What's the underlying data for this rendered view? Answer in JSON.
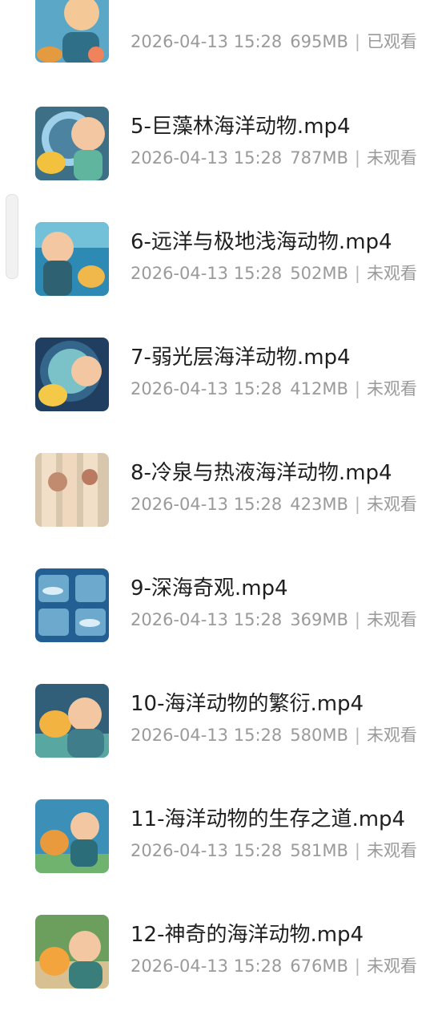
{
  "videos": [
    {
      "title": "",
      "date": "2026-04-13 15:28",
      "size": "695MB",
      "separator": "|",
      "status": "已观看",
      "thumb_colors": [
        "#5aa7c7",
        "#e49a3f",
        "#2f6f88"
      ]
    },
    {
      "title": "5-巨藻林海洋动物.mp4",
      "date": "2026-04-13 15:28",
      "size": "787MB",
      "separator": "|",
      "status": "未观看",
      "thumb_colors": [
        "#3d6f86",
        "#f2c23f",
        "#9fd0ea"
      ]
    },
    {
      "title": "6-远洋与极地浅海动物.mp4",
      "date": "2026-04-13 15:28",
      "size": "502MB",
      "separator": "|",
      "status": "未观看",
      "thumb_colors": [
        "#2c8ab4",
        "#f0b74b",
        "#73c1d8"
      ]
    },
    {
      "title": "7-弱光层海洋动物.mp4",
      "date": "2026-04-13 15:28",
      "size": "412MB",
      "separator": "|",
      "status": "未观看",
      "thumb_colors": [
        "#203e5f",
        "#f4c948",
        "#7ac2c8"
      ]
    },
    {
      "title": "8-冷泉与热液海洋动物.mp4",
      "date": "2026-04-13 15:28",
      "size": "423MB",
      "separator": "|",
      "status": "未观看",
      "thumb_colors": [
        "#d8c7ad",
        "#c18b6f",
        "#f1dfc7"
      ]
    },
    {
      "title": "9-深海奇观.mp4",
      "date": "2026-04-13 15:28",
      "size": "369MB",
      "separator": "|",
      "status": "未观看",
      "thumb_colors": [
        "#245f94",
        "#dbeef8",
        "#6ca9cd"
      ]
    },
    {
      "title": "10-海洋动物的繁衍.mp4",
      "date": "2026-04-13 15:28",
      "size": "580MB",
      "separator": "|",
      "status": "未观看",
      "thumb_colors": [
        "#315f7a",
        "#f2b340",
        "#58a7a0"
      ]
    },
    {
      "title": "11-海洋动物的生存之道.mp4",
      "date": "2026-04-13 15:28",
      "size": "581MB",
      "separator": "|",
      "status": "未观看",
      "thumb_colors": [
        "#3c8fb7",
        "#e89a3c",
        "#6fb36f"
      ]
    },
    {
      "title": "12-神奇的海洋动物.mp4",
      "date": "2026-04-13 15:28",
      "size": "676MB",
      "separator": "|",
      "status": "未观看",
      "thumb_colors": [
        "#6c9f5d",
        "#f4a43d",
        "#d9c093"
      ]
    }
  ]
}
